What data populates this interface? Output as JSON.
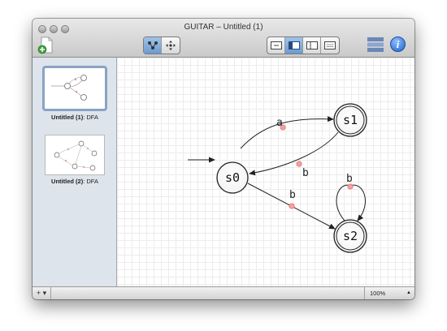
{
  "window": {
    "title": "GUITAR – Untitled (1)"
  },
  "toolbar": {
    "tool_modes": [
      "select-nodes-tool",
      "move-canvas-tool"
    ],
    "active_tool": 0,
    "view_modes": [
      "view-layout-1",
      "view-layout-2",
      "view-layout-3",
      "view-layout-4"
    ],
    "active_view": 1
  },
  "sidebar": {
    "items": [
      {
        "name": "Untitled (1)",
        "type": ": DFA",
        "selected": true
      },
      {
        "name": "Untitled (2)",
        "type": ": DFA",
        "selected": false
      }
    ]
  },
  "automaton": {
    "states": [
      "s0",
      "s1",
      "s2"
    ],
    "start_state": "s0",
    "accepting_states": [
      "s1",
      "s2"
    ],
    "transitions": [
      {
        "from": "s0",
        "to": "s1",
        "label": "a"
      },
      {
        "from": "s1",
        "to": "s0",
        "label": "b"
      },
      {
        "from": "s0",
        "to": "s2",
        "label": "b"
      },
      {
        "from": "s2",
        "to": "s2",
        "label": "b"
      }
    ]
  },
  "statusbar": {
    "add_label": "+ ▾",
    "zoom": "100%"
  },
  "colors": {
    "accent": "#6d9bd0",
    "handle": "#f08a8a",
    "sidebar": "#dde4ec"
  }
}
